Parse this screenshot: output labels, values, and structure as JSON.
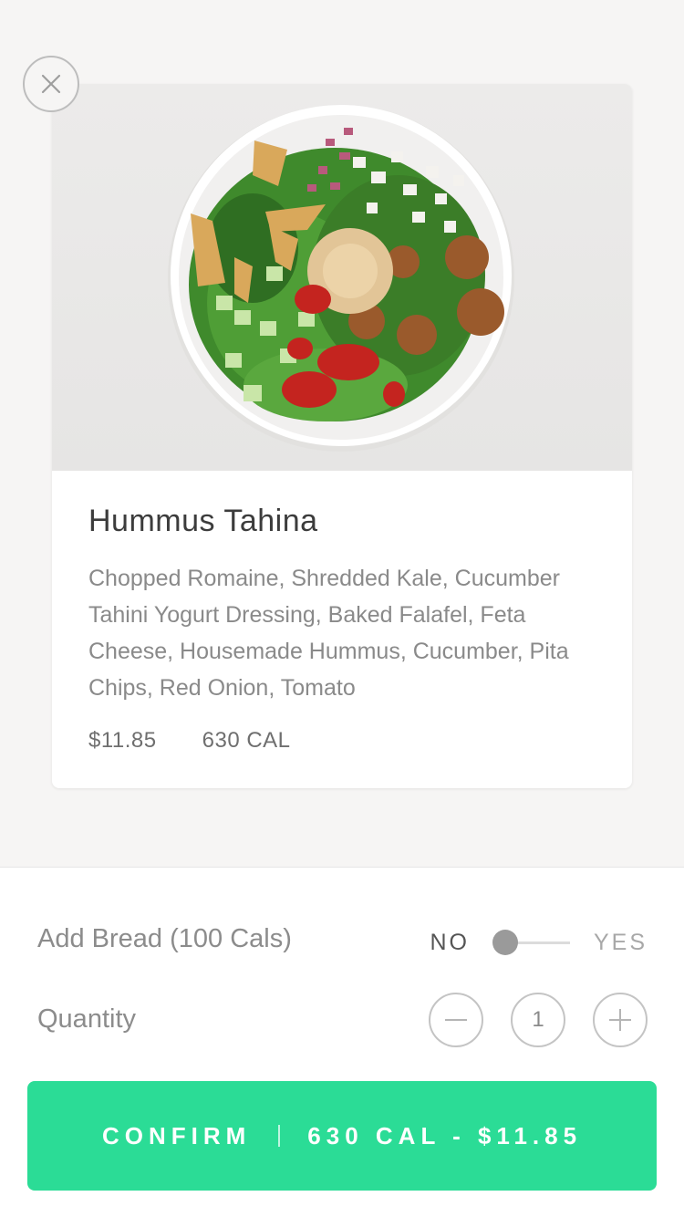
{
  "item": {
    "title": "Hummus Tahina",
    "description": "Chopped Romaine, Shredded Kale, Cucumber Tahini Yogurt Dressing, Baked Falafel, Feta Cheese, Housemade Hummus, Cucumber, Pita Chips, Red Onion, Tomato",
    "price": "$11.85",
    "calories": "630 CAL",
    "image_icon": "salad-bowl-photo"
  },
  "options": {
    "bread_label": "Add Bread (100 Cals)",
    "toggle_off_label": "NO",
    "toggle_on_label": "YES",
    "toggle_value": false,
    "quantity_label": "Quantity",
    "quantity_value": "1",
    "decrement_icon": "minus-icon",
    "increment_icon": "plus-icon"
  },
  "confirm": {
    "label": "CONFIRM",
    "summary": "630 CAL - $11.85"
  },
  "colors": {
    "accent": "#2bdc96",
    "background": "#f6f5f4"
  }
}
